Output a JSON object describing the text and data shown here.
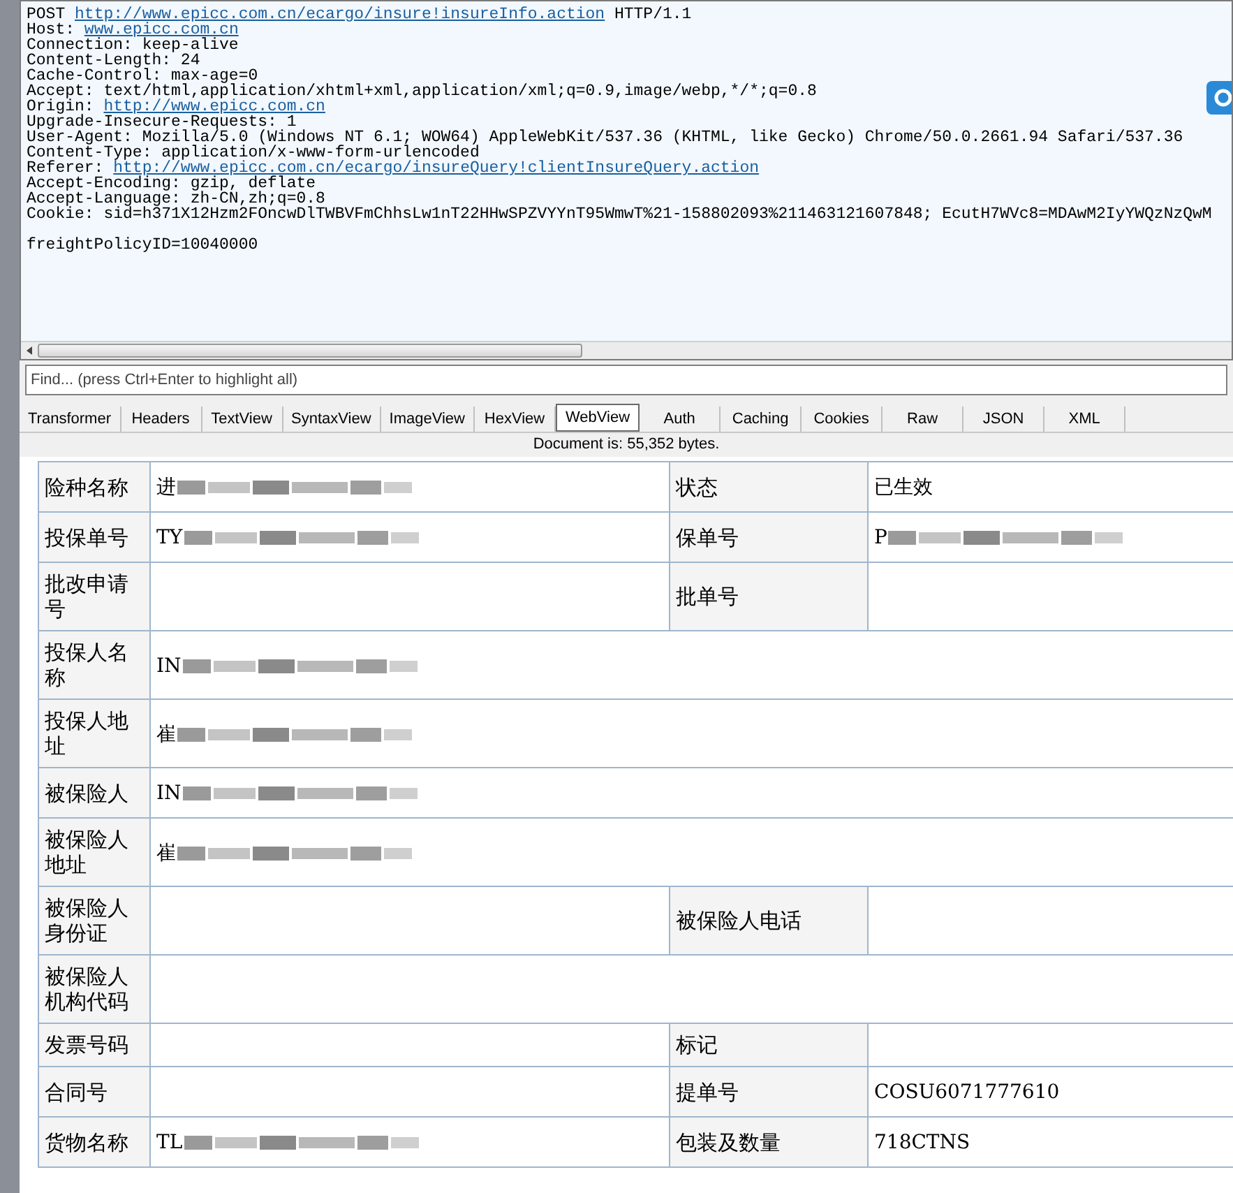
{
  "request": {
    "lines": [
      {
        "parts": [
          {
            "text": "POST "
          },
          {
            "text": "http://www.epicc.com.cn/ecargo/insure!insureInfo.action",
            "link": true
          },
          {
            "text": " HTTP/1.1"
          }
        ]
      },
      {
        "parts": [
          {
            "text": "Host: "
          },
          {
            "text": "www.epicc.com.cn",
            "link": true
          }
        ]
      },
      {
        "parts": [
          {
            "text": "Connection: keep-alive"
          }
        ]
      },
      {
        "parts": [
          {
            "text": "Content-Length: 24"
          }
        ]
      },
      {
        "parts": [
          {
            "text": "Cache-Control: max-age=0"
          }
        ]
      },
      {
        "parts": [
          {
            "text": "Accept: text/html,application/xhtml+xml,application/xml;q=0.9,image/webp,*/*;q=0.8"
          }
        ]
      },
      {
        "parts": [
          {
            "text": "Origin: "
          },
          {
            "text": "http://www.epicc.com.cn",
            "link": true
          }
        ]
      },
      {
        "parts": [
          {
            "text": "Upgrade-Insecure-Requests: 1"
          }
        ]
      },
      {
        "parts": [
          {
            "text": "User-Agent: Mozilla/5.0 (Windows NT 6.1; WOW64) AppleWebKit/537.36 (KHTML, like Gecko) Chrome/50.0.2661.94 Safari/537.36"
          }
        ]
      },
      {
        "parts": [
          {
            "text": "Content-Type: application/x-www-form-urlencoded"
          }
        ]
      },
      {
        "parts": [
          {
            "text": "Referer: "
          },
          {
            "text": "http://www.epicc.com.cn/ecargo/insureQuery!clientInsureQuery.action",
            "link": true
          }
        ]
      },
      {
        "parts": [
          {
            "text": "Accept-Encoding: gzip, deflate"
          }
        ]
      },
      {
        "parts": [
          {
            "text": "Accept-Language: zh-CN,zh;q=0.8"
          }
        ]
      },
      {
        "parts": [
          {
            "text": "Cookie: sid=h371X12Hzm2FOncwDlTWBVFmChhsLw1nT22HHwSPZVYYnT95WmwT%21-158802093%211463121607848; EcutH7WVc8=MDAwM2IyYWQzNzQwM"
          }
        ]
      }
    ],
    "body": "freightPolicyID=10040000"
  },
  "find": {
    "placeholder": "Find... (press Ctrl+Enter to highlight all)"
  },
  "tabs": [
    {
      "label": "Transformer",
      "selected": false
    },
    {
      "label": "Headers",
      "selected": false
    },
    {
      "label": "TextView",
      "selected": false
    },
    {
      "label": "SyntaxView",
      "selected": false
    },
    {
      "label": "ImageView",
      "selected": false
    },
    {
      "label": "HexView",
      "selected": false
    },
    {
      "label": "WebView",
      "selected": true
    },
    {
      "label": "Auth",
      "selected": false
    },
    {
      "label": "Caching",
      "selected": false
    },
    {
      "label": "Cookies",
      "selected": false
    },
    {
      "label": "Raw",
      "selected": false
    },
    {
      "label": "JSON",
      "selected": false
    },
    {
      "label": "XML",
      "selected": false
    }
  ],
  "status": "Document is: 55,352 bytes.",
  "table": {
    "rows": [
      {
        "cells": [
          {
            "label": "险种名称"
          },
          {
            "value": "进",
            "redacted": true
          },
          {
            "label": "状态"
          },
          {
            "value": "已生效"
          }
        ]
      },
      {
        "cells": [
          {
            "label": "投保单号"
          },
          {
            "value": "TY",
            "redacted": true
          },
          {
            "label": "保单号"
          },
          {
            "value": "P",
            "redacted": true
          }
        ]
      },
      {
        "cells": [
          {
            "label": "批改申请号"
          },
          {},
          {
            "label": "批单号"
          },
          {}
        ]
      },
      {
        "cells": [
          {
            "label": "投保人名称"
          },
          {
            "value": "IN",
            "redacted": true,
            "colspan": 3
          }
        ]
      },
      {
        "cells": [
          {
            "label": "投保人地址"
          },
          {
            "value": "崔",
            "redacted": true,
            "colspan": 3
          }
        ]
      },
      {
        "cells": [
          {
            "label": "被保险人"
          },
          {
            "value": "IN",
            "redacted": true,
            "colspan": 3
          }
        ]
      },
      {
        "cells": [
          {
            "label": "被保险人地址"
          },
          {
            "value": "崔",
            "redacted": true,
            "colspan": 3
          }
        ]
      },
      {
        "cells": [
          {
            "label": "被保险人身份证"
          },
          {},
          {
            "label": "被保险人电话"
          },
          {}
        ]
      },
      {
        "cells": [
          {
            "label": "被保险人机构代码"
          },
          {
            "colspan": 3
          }
        ]
      },
      {
        "cells": [
          {
            "label": "发票号码"
          },
          {},
          {
            "label": "标记"
          },
          {}
        ]
      },
      {
        "cells": [
          {
            "label": "合同号"
          },
          {},
          {
            "label": "提单号"
          },
          {
            "value": "COSU6071777610"
          }
        ]
      },
      {
        "cells": [
          {
            "label": "货物名称"
          },
          {
            "value": "TL",
            "redacted": true
          },
          {
            "label": "包装及数量"
          },
          {
            "value": "718CTNS"
          }
        ]
      }
    ]
  }
}
